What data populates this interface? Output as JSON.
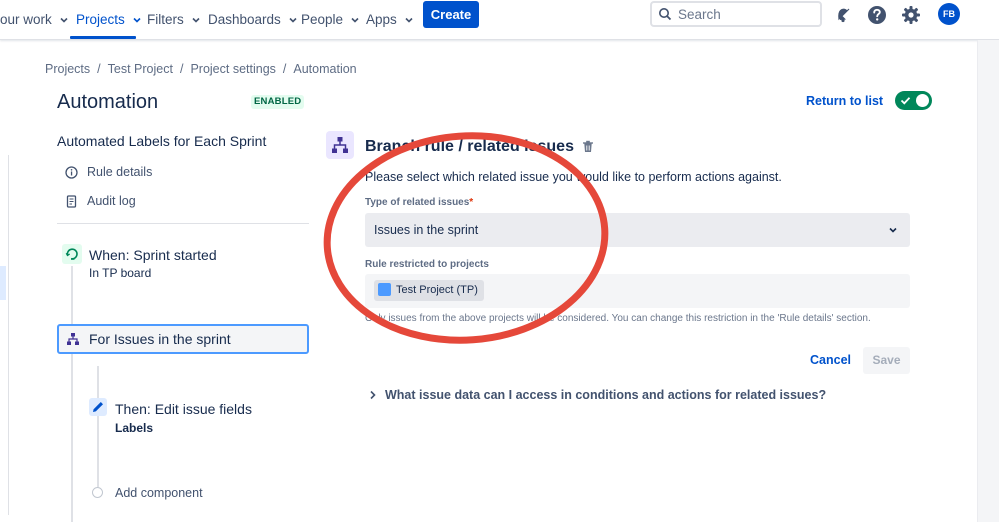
{
  "nav": {
    "items": [
      {
        "label": "our work"
      },
      {
        "label": "Projects"
      },
      {
        "label": "Filters"
      },
      {
        "label": "Dashboards"
      },
      {
        "label": "People"
      },
      {
        "label": "Apps"
      }
    ],
    "create_label": "Create",
    "search_placeholder": "Search",
    "avatar_initials": "FB",
    "active_color": "#0052cc"
  },
  "breadcrumb": [
    "Projects",
    "Test Project",
    "Project settings",
    "Automation"
  ],
  "header": {
    "title": "Automation",
    "status_badge": "ENABLED",
    "return_link": "Return to list",
    "rule_enabled": true
  },
  "rule": {
    "name": "Automated Labels for Each Sprint",
    "links": [
      {
        "label": "Rule details",
        "icon": "info-icon"
      },
      {
        "label": "Audit log",
        "icon": "document-icon"
      }
    ],
    "trigger": {
      "title": "When: Sprint started",
      "subtitle": "In TP board",
      "icon": "sprint-trigger-icon"
    },
    "branch": {
      "label": "For Issues in the sprint",
      "icon": "branch-icon"
    },
    "action": {
      "title": "Then: Edit issue fields",
      "subtitle": "Labels",
      "icon": "pencil-icon"
    },
    "add_component": "Add component"
  },
  "config": {
    "title": "Branch rule / related issues",
    "instruction": "Please select which related issue you would like to perform actions against.",
    "related_type_label": "Type of related issues",
    "related_type_required": "*",
    "related_type_value": "Issues in the sprint",
    "restricted_label": "Rule restricted to projects",
    "project_chip": "Test Project (TP)",
    "helper": "Only issues from the above projects will be considered. You can change this restriction in the 'Rule details' section.",
    "cancel_label": "Cancel",
    "save_label": "Save",
    "expander_label": "What issue data can I access in conditions and actions for related issues?"
  },
  "colors": {
    "annotation": "#e5483a",
    "enabled_green": "#00875a"
  }
}
